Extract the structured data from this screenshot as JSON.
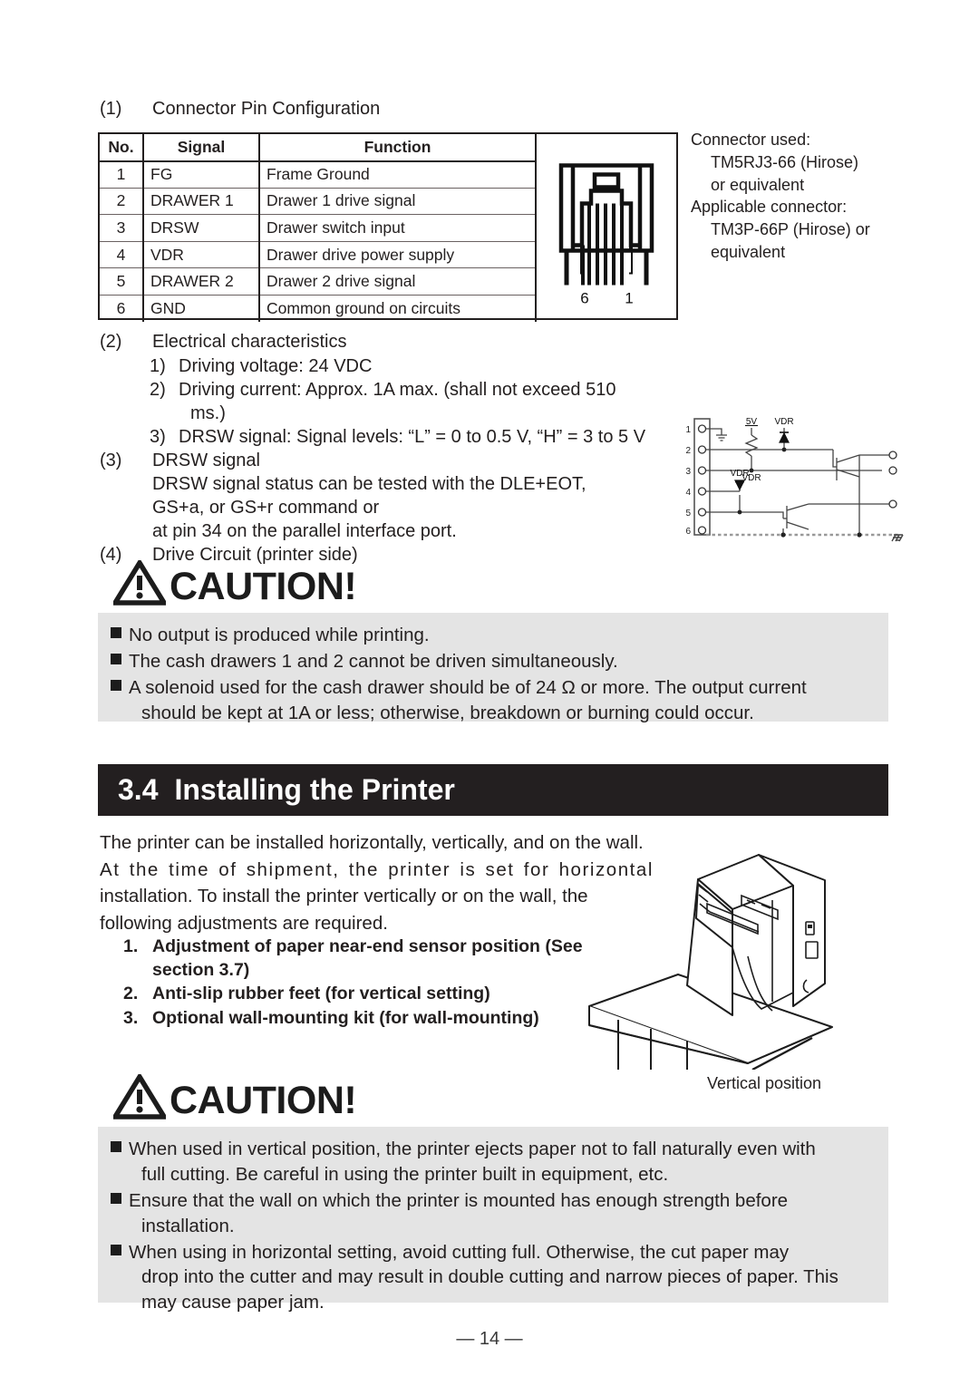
{
  "sections": {
    "s1": {
      "num": "(1)",
      "title": "Connector Pin Configuration"
    },
    "s2": {
      "num": "(2)",
      "title": "Electrical characteristics"
    },
    "s2_items": [
      {
        "num": "1)",
        "text": "Driving voltage: 24 VDC"
      },
      {
        "num": "2)",
        "text": "Driving current: Approx. 1A max. (shall not exceed 510",
        "cont": "ms.)"
      },
      {
        "num": "3)",
        "text": "DRSW signal: Signal levels: “L” = 0 to 0.5 V, “H” = 3 to 5 V"
      }
    ],
    "s3": {
      "num": "(3)",
      "title": "DRSW signal"
    },
    "s3_lines": [
      "DRSW signal status can be tested with  the DLE+EOT,",
      "GS+a, or GS+r command or",
      "at pin 34 on the parallel interface port."
    ],
    "s4": {
      "num": "(4)",
      "title": "Drive Circuit (printer side)"
    }
  },
  "pin_table": {
    "headers": [
      "No.",
      "Signal",
      "Function"
    ],
    "rows": [
      {
        "no": "1",
        "signal": "FG",
        "function": "Frame Ground"
      },
      {
        "no": "2",
        "signal": "DRAWER 1",
        "function": "Drawer 1 drive signal"
      },
      {
        "no": "3",
        "signal": "DRSW",
        "function": "Drawer switch input"
      },
      {
        "no": "4",
        "signal": "VDR",
        "function": "Drawer drive power supply"
      },
      {
        "no": "5",
        "signal": "DRAWER 2",
        "function": "Drawer 2 drive signal"
      },
      {
        "no": "6",
        "signal": "GND",
        "function": "Common ground on circuits"
      }
    ],
    "connector_pin_left": "6",
    "connector_pin_right": "1"
  },
  "connector_note": {
    "line1": "Connector used:",
    "line2": "TM5RJ3-66 (Hirose)",
    "line3": "or equivalent",
    "line4": "Applicable connector:",
    "line5": "TM3P-66P (Hirose) or",
    "line6": "equivalent"
  },
  "circuit": {
    "pin_labels": [
      "1",
      "2",
      "3",
      "4",
      "5",
      "6"
    ],
    "label_5v": "5V",
    "label_vdr_top": "VDR",
    "label_vdr_mid": "VDR",
    "label_vdr_low": "VDR"
  },
  "caution1": {
    "word": "CAUTION!",
    "icon": "warning-triangle-icon",
    "lines": [
      {
        "text": "No output is produced while printing.",
        "cont": ""
      },
      {
        "text": "The cash drawers 1 and 2 cannot be driven simultaneously.",
        "cont": ""
      },
      {
        "text": "A solenoid used for the cash drawer should be of 24 Ω or more.  The output current",
        "cont": "should be kept at 1A or less; otherwise, breakdown or burning could occur."
      }
    ]
  },
  "section_bar": {
    "number": "3.4",
    "title": "Installing the Printer"
  },
  "body_paragraph": {
    "line1": "The printer can be installed horizontally, vertically, and on the wall.",
    "line2": "At the time of shipment, the printer is set for horizontal",
    "line3": "installation.  To install the printer vertically or on the wall, the",
    "line4": "following adjustments are required."
  },
  "numbered_list": [
    {
      "num": "1.",
      "text": "Adjustment of paper near-end sensor position (See",
      "cont": "section 3.7)"
    },
    {
      "num": "2.",
      "text": "Anti-slip rubber feet (for vertical setting)",
      "cont": ""
    },
    {
      "num": "3.",
      "text": "Optional wall-mounting kit (for wall-mounting)",
      "cont": ""
    }
  ],
  "illustration": {
    "caption": "Vertical position"
  },
  "caution2": {
    "word": "CAUTION!",
    "icon": "warning-triangle-icon",
    "lines": [
      {
        "text": "When used in vertical position, the printer ejects paper not to fall naturally even with",
        "cont": "full cutting.  Be careful in using the printer built in equipment, etc."
      },
      {
        "text": "Ensure that the wall on which the printer is mounted has enough strength before",
        "cont": "installation."
      },
      {
        "text": "When using in horizontal setting, avoid cutting full.  Otherwise, the cut paper may",
        "cont": "drop into the cutter and may result in double cutting and narrow pieces of paper.  This",
        "cont2": "may cause paper jam."
      }
    ]
  },
  "footer": {
    "page": "— 14 —"
  },
  "colors": {
    "ink": "#231f1f",
    "bar": "#231f20",
    "caution_bg": "#e4e4e4"
  }
}
